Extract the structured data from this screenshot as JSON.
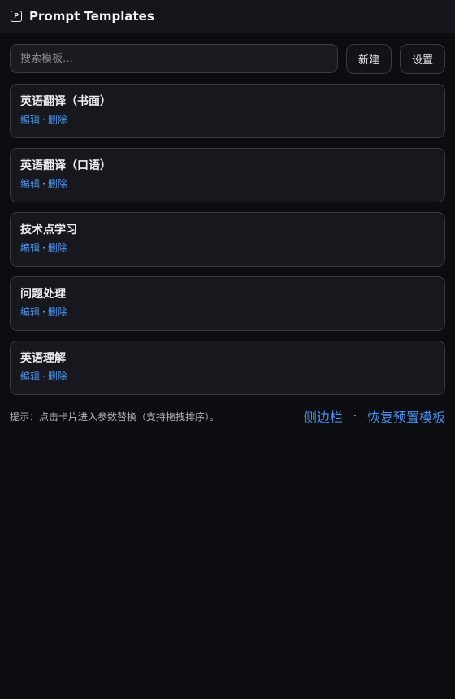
{
  "app": {
    "title": "Prompt Templates",
    "logo_letter": "P"
  },
  "toolbar": {
    "search_placeholder": "搜索模板…",
    "search_value": "",
    "new_label": "新建",
    "settings_label": "设置"
  },
  "templates": [
    {
      "name": "英语翻译（书面）",
      "edit": "编辑",
      "sep": "·",
      "delete": "删除"
    },
    {
      "name": "英语翻译（口语）",
      "edit": "编辑",
      "sep": "·",
      "delete": "删除"
    },
    {
      "name": "技术点学习",
      "edit": "编辑",
      "sep": "·",
      "delete": "删除"
    },
    {
      "name": "问题处理",
      "edit": "编辑",
      "sep": "·",
      "delete": "删除"
    },
    {
      "name": "英语理解",
      "edit": "编辑",
      "sep": "·",
      "delete": "删除"
    }
  ],
  "footer": {
    "hint": "提示：点击卡片进入参数替换（支持拖拽排序）。",
    "sidebar_link": "侧边栏",
    "separator": "·",
    "restore_link": "恢复预置模板"
  },
  "colors": {
    "background": "#0c0d11",
    "accent_link": "#4b8fea",
    "card_bg": "#17181d",
    "border": "#383a41"
  },
  "icons": {
    "logo": "p-box-logo-icon"
  }
}
